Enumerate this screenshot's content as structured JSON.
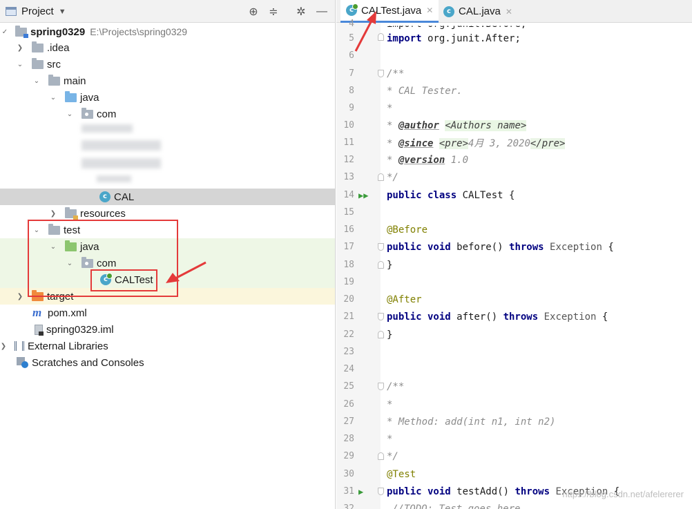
{
  "project_pane": {
    "title": "Project",
    "tools": [
      "crosshair-icon",
      "collapse-all-icon",
      "gear-icon",
      "hide-icon"
    ]
  },
  "tree": {
    "module": {
      "name": "spring0329",
      "path": "E:\\Projects\\spring0329"
    },
    "idea": ".idea",
    "src": "src",
    "main": "main",
    "main_java": "java",
    "main_com": "com",
    "cal_class": "CAL",
    "resources": "resources",
    "test": "test",
    "test_java": "java",
    "test_com": "com",
    "caltest_class": "CALTest",
    "target": "target",
    "pom": "pom.xml",
    "iml": "spring0329.iml",
    "external_libraries": "External Libraries",
    "scratches": "Scratches and Consoles"
  },
  "tabs": [
    {
      "label": "CALTest.java",
      "active": true
    },
    {
      "label": "CAL.java",
      "active": false
    }
  ],
  "code": {
    "l4": {
      "num": "4",
      "text": "import org.junit.Before;"
    },
    "l5": {
      "num": "5",
      "kw": "import",
      "text": " org.junit.After;"
    },
    "l6": {
      "num": "6"
    },
    "l7": {
      "num": "7",
      "text": "/**"
    },
    "l8": {
      "num": "8",
      "text": "* CAL Tester."
    },
    "l9": {
      "num": "9",
      "text": "*"
    },
    "l10": {
      "num": "10",
      "star": "* ",
      "tag": "@author",
      "val": "<Authors name>"
    },
    "l11": {
      "num": "11",
      "star": "* ",
      "tag": "@since",
      "pre_open": "<pre>",
      "val": "4月 3, 2020",
      "pre_close": "</pre>"
    },
    "l12": {
      "num": "12",
      "star": "* ",
      "tag": "@version",
      "val": " 1.0"
    },
    "l13": {
      "num": "13",
      "text": "*/"
    },
    "l14": {
      "num": "14",
      "kw": "public class",
      "text": " CALTest {"
    },
    "l15": {
      "num": "15"
    },
    "l16": {
      "num": "16",
      "ann": "@Before"
    },
    "l17": {
      "num": "17",
      "kw": "public void",
      "text": " before() ",
      "kw2": "throws",
      "exc": " Exception",
      "end": " {"
    },
    "l18": {
      "num": "18",
      "text": "}"
    },
    "l19": {
      "num": "19"
    },
    "l20": {
      "num": "20",
      "ann": "@After"
    },
    "l21": {
      "num": "21",
      "kw": "public void",
      "text": " after() ",
      "kw2": "throws",
      "exc": " Exception",
      "end": " {"
    },
    "l22": {
      "num": "22",
      "text": "}"
    },
    "l23": {
      "num": "23"
    },
    "l24": {
      "num": "24"
    },
    "l25": {
      "num": "25",
      "text": "/**"
    },
    "l26": {
      "num": "26",
      "text": "*"
    },
    "l27": {
      "num": "27",
      "text": "* Method: add(int n1, int n2)"
    },
    "l28": {
      "num": "28",
      "text": "*"
    },
    "l29": {
      "num": "29",
      "text": "*/"
    },
    "l30": {
      "num": "30",
      "ann": "@Test"
    },
    "l31": {
      "num": "31",
      "kw": "public void",
      "text": " testAdd() ",
      "kw2": "throws",
      "exc": " Exception",
      "end": " {"
    },
    "l32": {
      "num": "32",
      "text": "//TODO: Test goes here..."
    }
  },
  "watermark": "https://blog.csdn.net/afelererer"
}
